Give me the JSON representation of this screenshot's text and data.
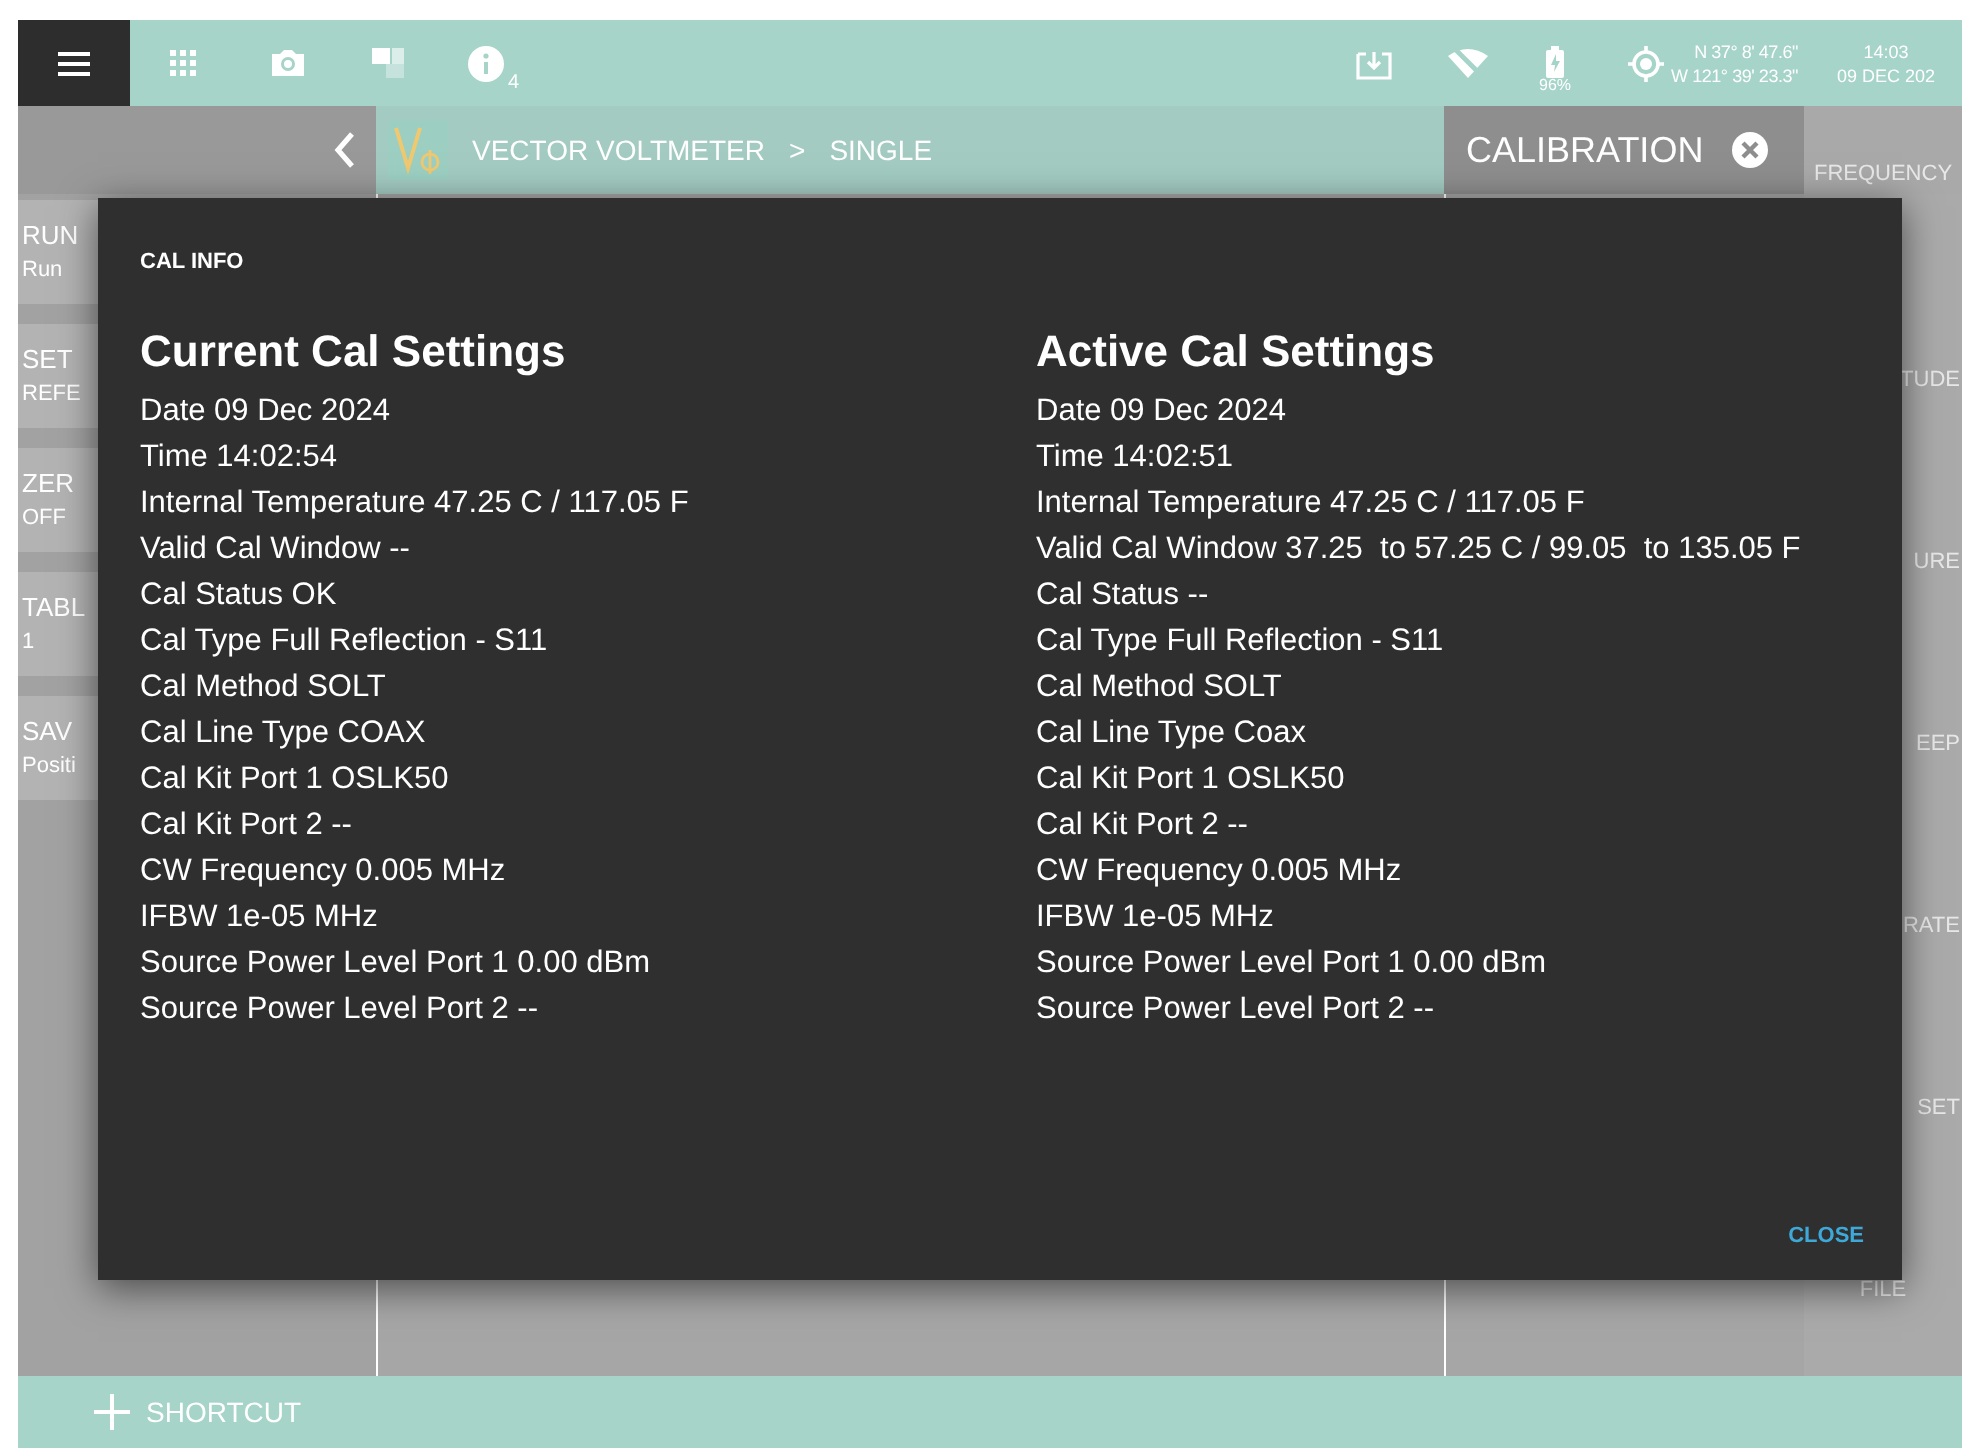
{
  "status_bar": {
    "info_count": "4",
    "battery": "96%",
    "latitude": "N 37° 8' 47.6\"",
    "longitude": "W 121° 39' 23.3\"",
    "time": "14:03",
    "date": "09 DEC 202"
  },
  "breadcrumb": {
    "mode": "VECTOR VOLTMETER",
    "separator": ">",
    "submode": "SINGLE"
  },
  "panel_tab": {
    "title": "CALIBRATION"
  },
  "left_buttons": [
    {
      "title": "RUN",
      "value": "Run"
    },
    {
      "title": "SET",
      "value": "REFE"
    },
    {
      "title": "ZER",
      "value": "OFF"
    },
    {
      "title": "TABL",
      "value": "1"
    },
    {
      "title": "SAV",
      "value": "Positi"
    }
  ],
  "right_menu": [
    "FREQUENCY",
    "TUDE",
    "URE",
    "EEP",
    "RATE",
    "SET",
    "FILE"
  ],
  "dialog": {
    "title": "CAL INFO",
    "close": "CLOSE",
    "columns": [
      {
        "heading": "Current Cal Settings",
        "lines": [
          "Date 09 Dec 2024",
          "Time 14:02:54",
          "Internal Temperature 47.25 C / 117.05 F",
          "Valid Cal Window --",
          "Cal Status OK",
          "Cal Type Full Reflection - S11",
          "Cal Method SOLT",
          "Cal Line Type COAX",
          "Cal Kit Port 1 OSLK50",
          "Cal Kit Port 2 --",
          "CW Frequency 0.005 MHz",
          "IFBW 1e-05 MHz",
          "Source Power Level Port 1 0.00 dBm",
          "Source Power Level Port 2 --"
        ]
      },
      {
        "heading": "Active Cal Settings",
        "lines": [
          "Date 09 Dec 2024",
          "Time 14:02:51",
          "Internal Temperature 47.25 C / 117.05 F",
          "Valid Cal Window 37.25  to 57.25 C / 99.05  to 135.05 F",
          "Cal Status --",
          "Cal Type Full Reflection - S11",
          "Cal Method SOLT",
          "Cal Line Type Coax",
          "Cal Kit Port 1 OSLK50",
          "Cal Kit Port 2 --",
          "CW Frequency 0.005 MHz",
          "IFBW 1e-05 MHz",
          "Source Power Level Port 1 0.00 dBm",
          "Source Power Level Port 2 --"
        ]
      }
    ]
  },
  "shortcut": {
    "label": "SHORTCUT"
  }
}
